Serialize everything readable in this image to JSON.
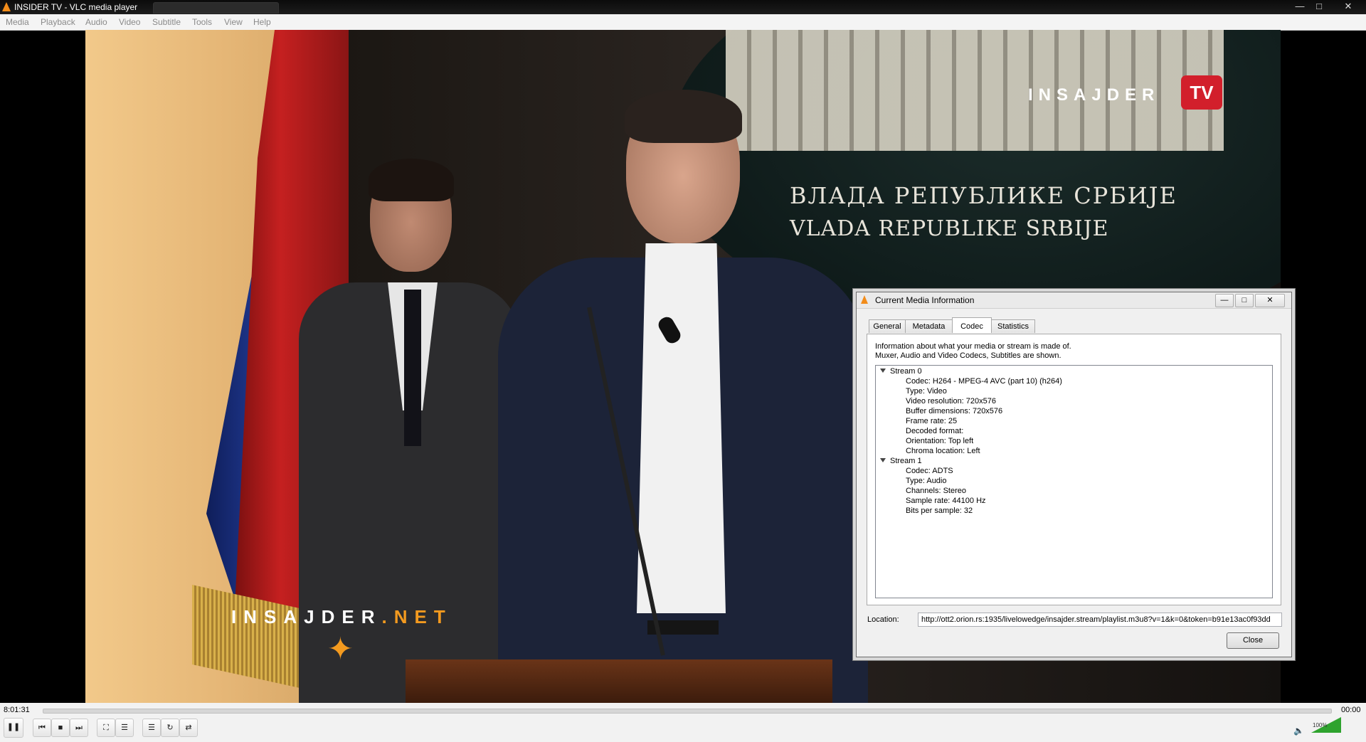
{
  "window": {
    "title": "INSIDER TV - VLC media player"
  },
  "menu": [
    "Media",
    "Playback",
    "Audio",
    "Video",
    "Subtitle",
    "Tools",
    "View",
    "Help"
  ],
  "video": {
    "banner_line1": "ВЛАДА РЕПУБЛИКЕ СРБИЈЕ",
    "banner_line2": "VLADA REPUBLIKE SRBIJE",
    "logo_text": "INSAJDER",
    "logo_badge": "TV",
    "watermark_main": "INSAJDER",
    "watermark_suffix": ".NET"
  },
  "dialog": {
    "title": "Current Media Information",
    "tabs": [
      "General",
      "Metadata",
      "Codec",
      "Statistics"
    ],
    "active_tab": "Codec",
    "description_line1": "Information about what your media or stream is made of.",
    "description_line2": "Muxer, Audio and Video Codecs, Subtitles are shown.",
    "streams": [
      {
        "name": "Stream 0",
        "items": [
          "Codec: H264 - MPEG-4 AVC (part 10) (h264)",
          "Type: Video",
          "Video resolution: 720x576",
          "Buffer dimensions: 720x576",
          "Frame rate: 25",
          "Decoded format:",
          "Orientation: Top left",
          "Chroma location: Left"
        ]
      },
      {
        "name": "Stream 1",
        "items": [
          "Codec: ADTS",
          "Type: Audio",
          "Channels: Stereo",
          "Sample rate: 44100 Hz",
          "Bits per sample: 32"
        ]
      }
    ],
    "location_label": "Location:",
    "location_value": "http://ott2.orion.rs:1935/livelowedge/insajder.stream/playlist.m3u8?v=1&k=0&token=b91e13ac0f93dd",
    "close_label": "Close"
  },
  "controls": {
    "time_elapsed": "8:01:31",
    "time_total": "00:00",
    "volume": "100%",
    "volume_level": 1.0
  },
  "colors": {
    "accent": "#f28c1a",
    "badge": "#d21f2b",
    "volume": "#2ea32e"
  }
}
